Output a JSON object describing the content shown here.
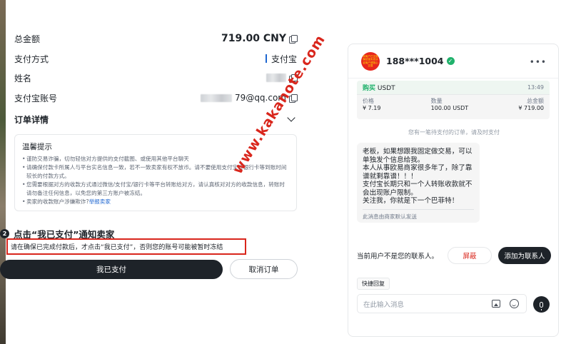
{
  "order": {
    "total_label": "总金额",
    "total_value": "719.00 CNY",
    "pay_method_label": "支付方式",
    "pay_method_value": "支付宝",
    "name_label": "姓名",
    "account_label": "支付宝账号",
    "account_value": "79@qq.com",
    "details_label": "订单详情"
  },
  "tips": {
    "title": "温馨提示",
    "items": [
      "谨防交易诈骗，切勿轻信对方提供的支付截图、或使用其他平台聊天",
      "请确保付款卡所属人与平台实名信息一致，若不一致卖家有权不放币。请不要使用支付宝转银行卡等到账时间较长的付款方式。",
      "您需要根据对方的收款方式通过微信/支付宝/银行卡等平台转账给对方，请认真核对对方的收款信息，转账时请勿备注任何信息，以免您的第三方账户被冻结。",
      "卖家的收款账户涉嫌欺诈?"
    ],
    "report_link": "举报卖家"
  },
  "step": {
    "number": "2",
    "title": "点击“我已支付”通知卖家",
    "warning": "请在确保已完成付款后，才点击“我已支付”，否则您的账号可能被暂时冻结"
  },
  "buttons": {
    "paid": "我已支付",
    "cancel": "取消订单"
  },
  "watermark": "www.kakanote.com",
  "chat": {
    "name": "188***1004",
    "more": "•••",
    "avatar_text": "本商户已交易保证金实名认证商户请放心交易",
    "order": {
      "side": "购买",
      "asset": "USDT",
      "time": "13:49",
      "price_label": "价格",
      "price": "¥ 7.19",
      "qty_label": "数量",
      "qty": "100.00 USDT",
      "total_label": "总金额",
      "total": "¥ 719.00"
    },
    "system_message": "您有一笔待支付的订单，请及时支付",
    "bubble": "老板，如果想跟我固定做交易，可以单独发个信息给我。\n本人从事欧易商家很多年了，除了靠谱就剩靠谱！！！\n支付宝长期只和一个人转账收款就不会出现账户限制。\n关注我，你就是下一个巴菲特！",
    "bubble_footer": "此消息由商家默认发送",
    "contact_text": "当前用户不是您的联系人。",
    "block_button": "屏蔽",
    "add_button": "添加为联系人",
    "quick_reply": "快捷回复",
    "input_placeholder": "在此输入消息"
  },
  "colors": {
    "accent_green": "#20b26c",
    "danger_red": "#d9261c",
    "primary_dark": "#1e2329"
  }
}
